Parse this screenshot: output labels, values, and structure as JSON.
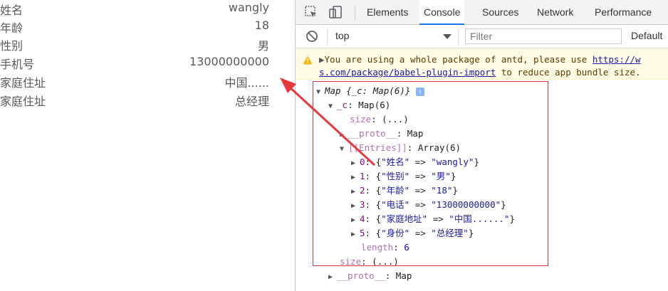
{
  "left_page": {
    "rows": [
      {
        "label": "姓名",
        "value": "wangly"
      },
      {
        "label": "年龄",
        "value": "18"
      },
      {
        "label": "性别",
        "value": "男"
      },
      {
        "label": "手机号",
        "value": "13000000000"
      },
      {
        "label": "家庭住址",
        "value": "中国......"
      },
      {
        "label": "家庭住址",
        "value": "总经理"
      }
    ]
  },
  "devtools": {
    "tabs": [
      {
        "label": "Elements"
      },
      {
        "label": "Console",
        "active": true
      },
      {
        "label": "Sources"
      },
      {
        "label": "Network"
      },
      {
        "label": "Performance"
      }
    ],
    "icons": {
      "inspect": "cursor-select-icon",
      "device": "device-toggle-icon",
      "clear": "block-icon"
    },
    "filterbar": {
      "context": "top",
      "filter_placeholder": "Filter",
      "levels": "Default"
    },
    "warning": {
      "line1_text": "You are using a whole package of antd, please use ",
      "line1_link": "https://w",
      "line2_link": "s.com/package/babel-plugin-import",
      "line2_text": " to reduce app bundle size."
    },
    "tree": {
      "root": "Map {_c: Map(6)}",
      "c_key": "_c",
      "c_val": "Map(6)",
      "size_key": "size",
      "size_val": "(...)",
      "proto_key": "__proto__",
      "proto_val": "Map",
      "entries_key": "[[Entries]]",
      "entries_val": "Array(6)",
      "entries": [
        {
          "index": "0",
          "key": "\"姓名\"",
          "value": "\"wangly\""
        },
        {
          "index": "1",
          "key": "\"性别\"",
          "value": "\"男\""
        },
        {
          "index": "2",
          "key": "\"年龄\"",
          "value": "\"18\""
        },
        {
          "index": "3",
          "key": "\"电话\"",
          "value": "\"13000000000\""
        },
        {
          "index": "4",
          "key": "\"家庭地址\"",
          "value": "\"中国......\""
        },
        {
          "index": "5",
          "key": "\"身份\"",
          "value": "\"总经理\""
        }
      ],
      "length_key": "length",
      "length_val": "6",
      "outer_size_key": "size",
      "outer_size_val": "(...)",
      "outer_proto_key": "__proto__",
      "outer_proto_val": "Map"
    }
  },
  "colors": {
    "annotation": "#d9363e",
    "tab_active": "#1a73e8",
    "warning_bg": "#fffbe5"
  }
}
